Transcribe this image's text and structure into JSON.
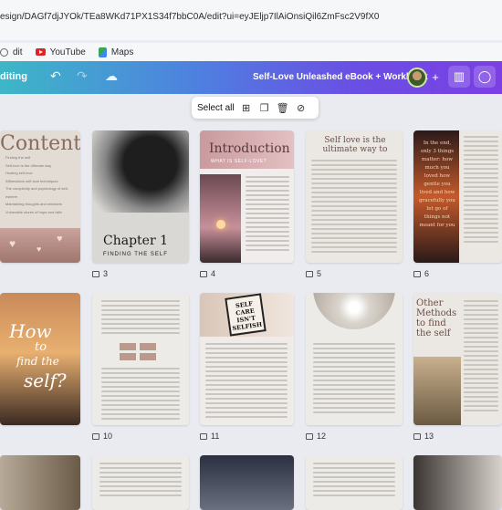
{
  "browser": {
    "url": "esign/DAGf7djJYOk/TEa8WKd71PX1S34f7bbC0A/edit?ui=eyJEljp7IlAiOnsiQil6ZmFsc2V9fX0",
    "bookmarks": [
      {
        "label": "dit",
        "icon": "globe-icon"
      },
      {
        "label": "YouTube",
        "icon": "youtube-icon"
      },
      {
        "label": "Maps",
        "icon": "maps-icon"
      }
    ]
  },
  "toolbar": {
    "mode": "diting",
    "title": "Self-Love Unleashed eBook + Workbook",
    "gradient": [
      "#3db7c7",
      "#7b3fe3"
    ]
  },
  "selection_bar": {
    "select_all": "Select all"
  },
  "pages": {
    "p2": {
      "title": "Content",
      "items": [
        "Finding the self",
        "Self-love is the Ultimate way",
        "Healing self-love",
        "Affirmations self-love techniques",
        "The complexity and psychology of self-esteem",
        "Maintaining thoughts and mindsets",
        "Vulnerable stores of hope and faith"
      ]
    },
    "p3": {
      "number": "3",
      "title": "Chapter 1",
      "subtitle": "FINDING THE SELF"
    },
    "p4": {
      "number": "4",
      "title": "Introduction",
      "subtitle": "WHAT IS SELF-LOVE?"
    },
    "p5": {
      "number": "5",
      "title": "Self love is the ultimate way to"
    },
    "p6": {
      "number": "6",
      "quote": "In the end, only 3 things matter: how much you loved how gentle you lived and how gracefully you let go of things not meant for you"
    },
    "p10": {
      "number": "10",
      "title_a": "How",
      "title_b": "to",
      "title_c": "find the",
      "title_d": "self?"
    },
    "p11": {
      "number": "11",
      "sign": "SELF CARE ISN'T SELFISH"
    },
    "p12": {
      "number": "12"
    },
    "p13": {
      "number": "13",
      "title": "Other Methods to find the self"
    }
  }
}
